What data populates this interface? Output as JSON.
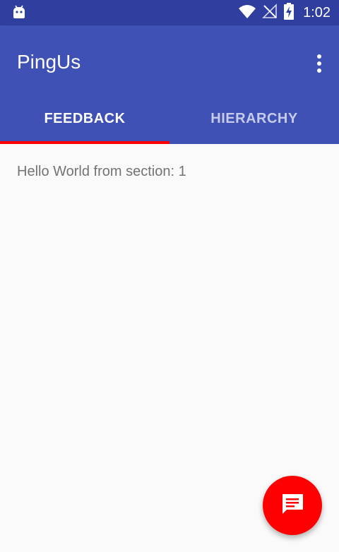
{
  "status_bar": {
    "time": "1:02",
    "icons": [
      "android-icon",
      "wifi-icon",
      "no-signal-icon",
      "battery-charging-icon"
    ],
    "color": "#303F9F"
  },
  "app_bar": {
    "title": "PingUs",
    "color": "#3F51B5",
    "overflow_icon": "more-vert-icon"
  },
  "tabs": [
    {
      "label": "FEEDBACK",
      "selected": true
    },
    {
      "label": "HIERARCHY",
      "selected": false
    }
  ],
  "tab_indicator_color": "#FF0000",
  "content": {
    "text": "Hello World from section: 1"
  },
  "fab": {
    "icon": "message-icon",
    "color": "#FF0000"
  }
}
